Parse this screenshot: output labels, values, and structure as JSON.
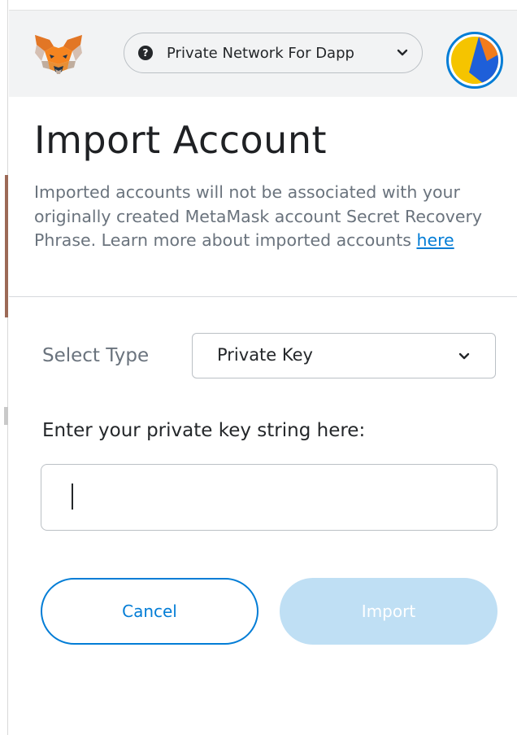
{
  "header": {
    "network": {
      "label": "Private Network For Dapp",
      "status_glyph": "?",
      "icon": "chevron-down-icon"
    },
    "logo": "metamask-fox-icon",
    "avatar": "account-identicon"
  },
  "page": {
    "title": "Import Account",
    "description_text": "Imported accounts will not be associated with your originally created MetaMask account Secret Recovery Phrase. Learn more about imported accounts ",
    "description_link": "here"
  },
  "form": {
    "select_type_label": "Select Type",
    "select_type_value": "Private Key",
    "key_label": "Enter your private key string here:",
    "key_value": "",
    "key_placeholder": ""
  },
  "buttons": {
    "cancel": "Cancel",
    "import": "Import"
  },
  "colors": {
    "accent": "#037dd6",
    "import_disabled": "#bfdff4",
    "header_bg": "#f2f3f4",
    "muted_text": "#6a737d"
  }
}
